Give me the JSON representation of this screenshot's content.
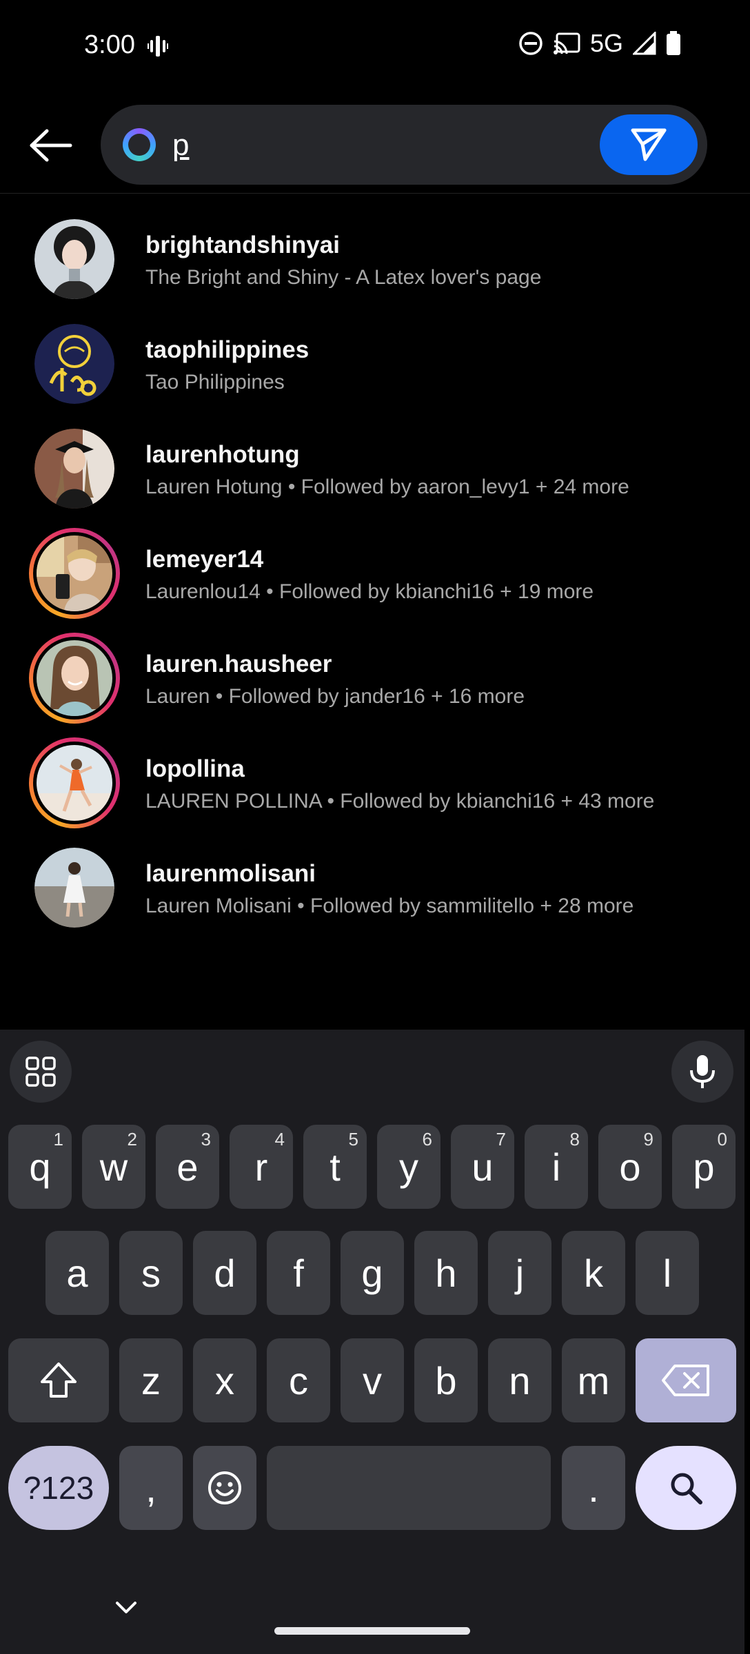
{
  "status_bar": {
    "time": "3:00",
    "network": "5G",
    "icons": [
      "vibrate-icon",
      "do-not-disturb-icon",
      "cast-icon",
      "signal-icon",
      "battery-icon"
    ]
  },
  "search": {
    "value": "p",
    "placeholder": "",
    "send_icon": "send-icon",
    "back_icon": "arrow-left-icon",
    "ai_icon": "meta-ai-ring-icon"
  },
  "results": [
    {
      "username": "brightandshinyai",
      "subtitle": "The Bright and Shiny - A Latex lover's page",
      "story_ring": false
    },
    {
      "username": "taophilippines",
      "subtitle": "Tao Philippines",
      "story_ring": false
    },
    {
      "username": "laurenhotung",
      "subtitle": "Lauren Hotung • Followed by aaron_levy1 + 24 more",
      "story_ring": false
    },
    {
      "username": "lemeyer14",
      "subtitle": "Laurenlou14 • Followed by kbianchi16 + 19 more",
      "story_ring": true
    },
    {
      "username": "lauren.hausheer",
      "subtitle": "Lauren • Followed by jander16 + 16 more",
      "story_ring": true
    },
    {
      "username": "lopollina",
      "subtitle": "LAUREN POLLINA • Followed by kbianchi16 + 43 more",
      "story_ring": true
    },
    {
      "username": "laurenmolisani",
      "subtitle": "Lauren Molisani • Followed by sammilitello + 28 more",
      "story_ring": false
    }
  ],
  "keyboard": {
    "row1": [
      {
        "k": "q",
        "h": "1"
      },
      {
        "k": "w",
        "h": "2"
      },
      {
        "k": "e",
        "h": "3"
      },
      {
        "k": "r",
        "h": "4"
      },
      {
        "k": "t",
        "h": "5"
      },
      {
        "k": "y",
        "h": "6"
      },
      {
        "k": "u",
        "h": "7"
      },
      {
        "k": "i",
        "h": "8"
      },
      {
        "k": "o",
        "h": "9"
      },
      {
        "k": "p",
        "h": "0"
      }
    ],
    "row2": [
      "a",
      "s",
      "d",
      "f",
      "g",
      "h",
      "j",
      "k",
      "l"
    ],
    "row3": [
      "z",
      "x",
      "c",
      "v",
      "b",
      "n",
      "m"
    ],
    "symbols_label": "?123",
    "comma": ",",
    "period": "."
  },
  "colors": {
    "accent": "#0a66f0",
    "background": "#000000",
    "keyboard_bg": "#1c1c20",
    "subtitle": "#a8a8a8"
  }
}
